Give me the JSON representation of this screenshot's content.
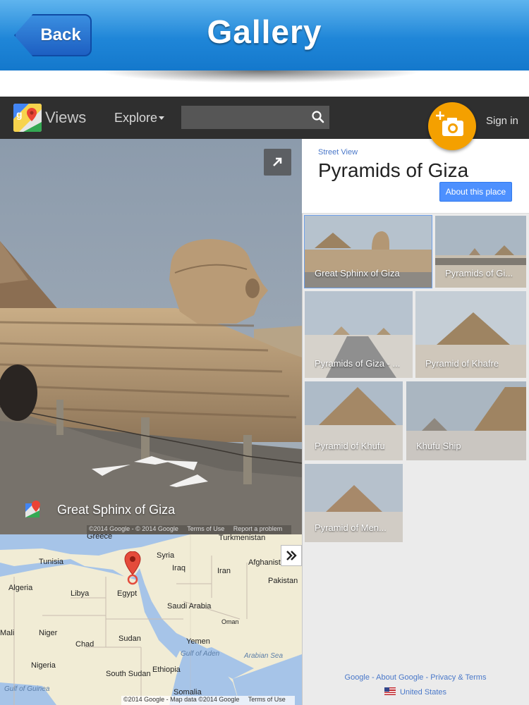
{
  "app_header": {
    "back_label": "Back",
    "title": "Gallery"
  },
  "topbar": {
    "brand": "Views",
    "explore_label": "Explore",
    "search_placeholder": "",
    "sign_in_label": "Sign in"
  },
  "pano": {
    "caption": "Great Sphinx of Giza",
    "footer": [
      "©2014 Google - © 2014 Google",
      "Terms of Use",
      "Report a problem"
    ]
  },
  "map": {
    "labels": [
      "Greece",
      "Turkmenistan",
      "Tunisia",
      "Syria",
      "Iraq",
      "Iran",
      "Afghanistan",
      "Algeria",
      "Libya",
      "Egypt",
      "Pakistan",
      "Saudi Arabia",
      "Oman",
      "Mali",
      "Niger",
      "Chad",
      "Sudan",
      "Yemen",
      "Gulf of Aden",
      "Arabian Sea",
      "Nigeria",
      "South Sudan",
      "Ethiopia",
      "Gulf of Guinea",
      "Somalia"
    ],
    "footer": [
      "©2014 Google - Map data ©2014 Google",
      "Terms of Use"
    ]
  },
  "panel": {
    "section_label": "Street View",
    "title": "Pyramids of Giza",
    "about_button": "About this place",
    "thumbnails": [
      {
        "label": "Great Sphinx of Giza"
      },
      {
        "label": "Pyramids of Gi..."
      },
      {
        "label": "Pyramids of Giza - ..."
      },
      {
        "label": "Pyramid of Khafre"
      },
      {
        "label": "Pyramid of Khufu"
      },
      {
        "label": "Khufu Ship"
      },
      {
        "label": "Pyramid of Men..."
      }
    ],
    "footer_links": "Google - About Google - Privacy & Terms",
    "region": "United States"
  },
  "colors": {
    "header_blue": "#1f86d8",
    "topbar": "#2f2f2f",
    "fab_orange": "#f4a000",
    "link_blue": "#4a78c9",
    "button_blue": "#4d90fe"
  }
}
